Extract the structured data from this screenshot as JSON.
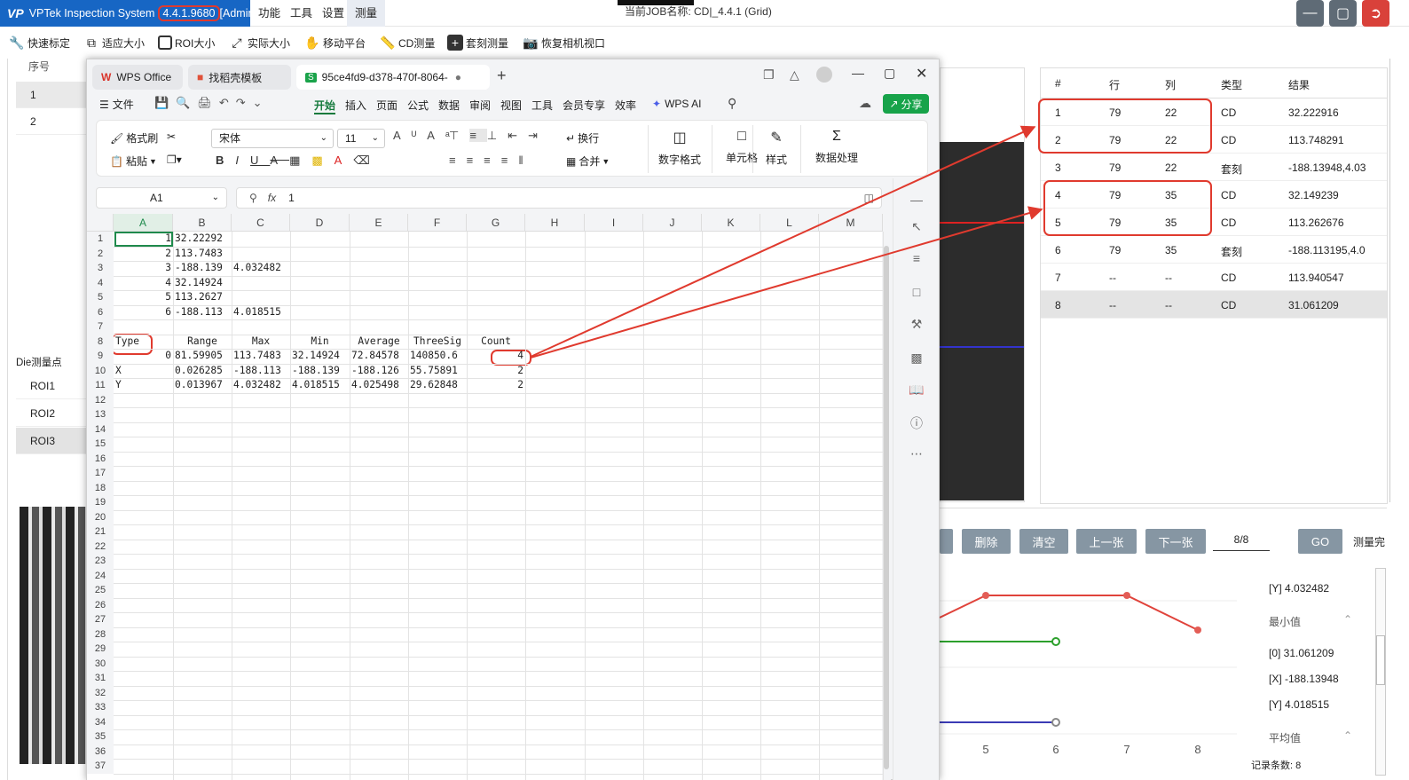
{
  "vp": {
    "brand_prefix": "VP",
    "title": "VPTek Inspection System",
    "version": "4.4.1.9680",
    "role": "[Admin]",
    "menu": [
      "功能",
      "工具",
      "设置",
      "测量"
    ],
    "job_label": "当前JOB名称: CD|_4.4.1 (Grid)",
    "toolbar": [
      "快速标定",
      "适应大小",
      "ROI大小",
      "实际大小",
      "移动平台",
      "CD测量",
      "套刻测量",
      "恢复相机视口"
    ],
    "left_header": "序号",
    "left_rows": [
      "1",
      "2"
    ],
    "die_label": "Die测量点",
    "roi_items": [
      "ROI1",
      "ROI2",
      "ROI3"
    ],
    "table_headers": [
      "#",
      "行",
      "列",
      "类型",
      "结果"
    ],
    "table_rows": [
      [
        "1",
        "79",
        "22",
        "CD",
        "32.222916"
      ],
      [
        "2",
        "79",
        "22",
        "CD",
        "113.748291"
      ],
      [
        "3",
        "79",
        "22",
        "套刻",
        "-188.13948,4.03"
      ],
      [
        "4",
        "79",
        "35",
        "CD",
        "32.149239"
      ],
      [
        "5",
        "79",
        "35",
        "CD",
        "113.262676"
      ],
      [
        "6",
        "79",
        "35",
        "套刻",
        "-188.113195,4.0"
      ],
      [
        "7",
        "--",
        "--",
        "CD",
        "113.940547"
      ],
      [
        "8",
        "--",
        "--",
        "CD",
        "31.061209"
      ]
    ],
    "buttons": [
      "删除",
      "清空",
      "上一张",
      "下一张",
      "GO"
    ],
    "page_indicator": "8/8",
    "measure_done": "测量完",
    "stats": {
      "y_max": "[Y]   4.032482",
      "min_header": "最小值",
      "min_vals": [
        "[0]   31.061209",
        "[X]   -188.13948",
        "[Y]   4.018515"
      ],
      "avg_header": "平均值",
      "record_count": "记录条数: 8"
    },
    "chart_x_labels": [
      "5",
      "6",
      "7",
      "8"
    ]
  },
  "wps": {
    "tabs": [
      "WPS Office",
      "找稻壳模板",
      "95ce4fd9-d378-470f-8064-"
    ],
    "menu": [
      "文件",
      "开始",
      "插入",
      "页面",
      "公式",
      "数据",
      "审阅",
      "视图",
      "工具",
      "会员专享",
      "效率",
      "WPS AI"
    ],
    "share": "分享",
    "ribbon": {
      "format_painter": "格式刷",
      "paste": "粘贴",
      "font": "宋体",
      "size": "11",
      "wrap": "换行",
      "merge": "合并",
      "number_format": "数字格式",
      "cell": "单元格",
      "style": "样式",
      "data_proc": "数据处理"
    },
    "name_box": "A1",
    "formula": "1",
    "columns": [
      "A",
      "B",
      "C",
      "D",
      "E",
      "F",
      "G",
      "H",
      "I",
      "J",
      "K",
      "L",
      "M"
    ],
    "rows": [
      [
        "1",
        "32.22292",
        "",
        "",
        "",
        "",
        ""
      ],
      [
        "2",
        "113.7483",
        "",
        "",
        "",
        "",
        ""
      ],
      [
        "3",
        "-188.139",
        "4.032482",
        "",
        "",
        "",
        ""
      ],
      [
        "4",
        "32.14924",
        "",
        "",
        "",
        "",
        ""
      ],
      [
        "5",
        "113.2627",
        "",
        "",
        "",
        "",
        ""
      ],
      [
        "6",
        "-188.113",
        "4.018515",
        "",
        "",
        "",
        ""
      ],
      [
        "",
        "",
        "",
        "",
        "",
        "",
        ""
      ],
      [
        "Type",
        "Range",
        "Max",
        "Min",
        "Average",
        "ThreeSig",
        "Count"
      ],
      [
        "0",
        "81.59905",
        "113.7483",
        "32.14924",
        "72.84578",
        "140850.6",
        "4"
      ],
      [
        "X",
        "0.026285",
        "-188.113",
        "-188.139",
        "-188.126",
        "55.75891",
        "2"
      ],
      [
        "Y",
        "0.013967",
        "4.032482",
        "4.018515",
        "4.025498",
        "29.62848",
        "2"
      ]
    ],
    "row_count": 37
  }
}
